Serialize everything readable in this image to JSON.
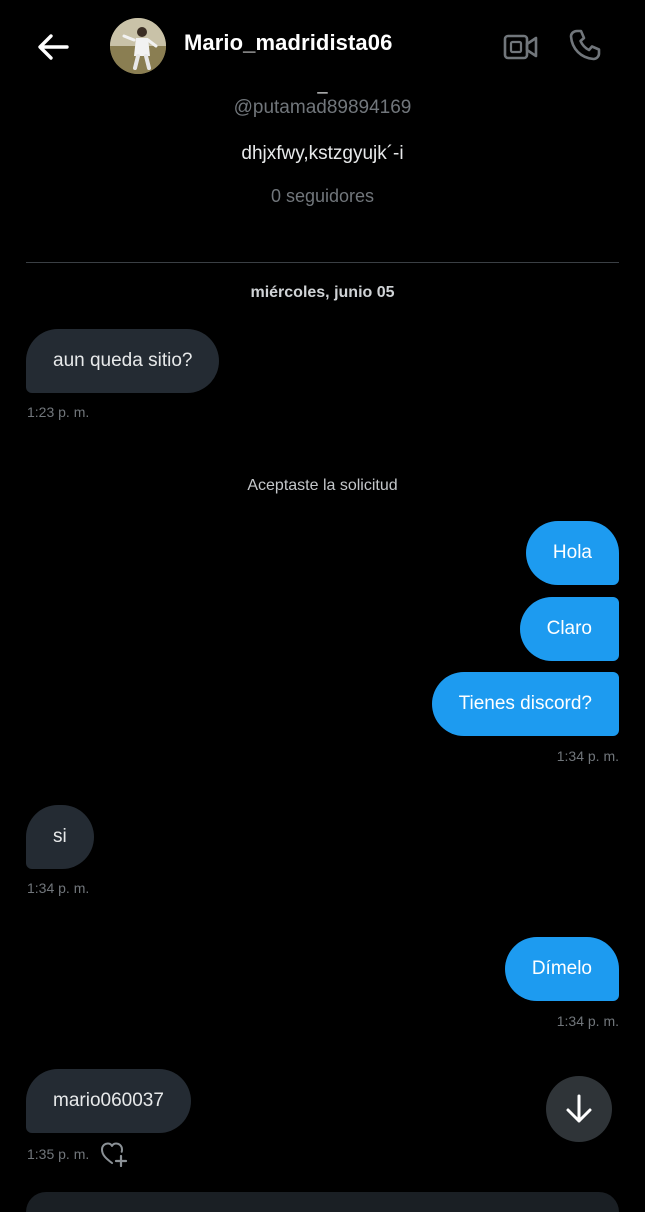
{
  "header": {
    "back_icon": "arrow-left-icon",
    "contact_name": "Mario_madridista06",
    "avatar_icon": "avatar-image",
    "video_icon": "video-call-icon",
    "phone_icon": "phone-icon"
  },
  "profile": {
    "dash": "_",
    "handle": "@putamad89894169",
    "bio": "dhjxfwy,kstzgyujk´-i",
    "followers": "0 seguidores"
  },
  "conversation": {
    "date_separator": "miércoles, junio 05",
    "system_note": "Aceptaste la solicitud",
    "messages": [
      {
        "direction": "in",
        "text": "aun queda sitio?",
        "time": "1:23 p. m."
      },
      {
        "direction": "out",
        "text": "Hola"
      },
      {
        "direction": "out",
        "text": "Claro"
      },
      {
        "direction": "out",
        "text": "Tienes discord?",
        "time": "1:34 p. m."
      },
      {
        "direction": "in",
        "text": "si",
        "time": "1:34 p. m."
      },
      {
        "direction": "out",
        "text": "Dímelo",
        "time": "1:34 p. m."
      },
      {
        "direction": "in",
        "text": "mario060037",
        "time": "1:35 p. m."
      }
    ]
  },
  "controls": {
    "react_icon": "heart-plus-icon",
    "scroll_down_icon": "arrow-down-icon"
  },
  "colors": {
    "background": "#000000",
    "outgoing_bubble": "#1d9bf0",
    "incoming_bubble": "#242b33",
    "muted_text": "#71767b"
  }
}
